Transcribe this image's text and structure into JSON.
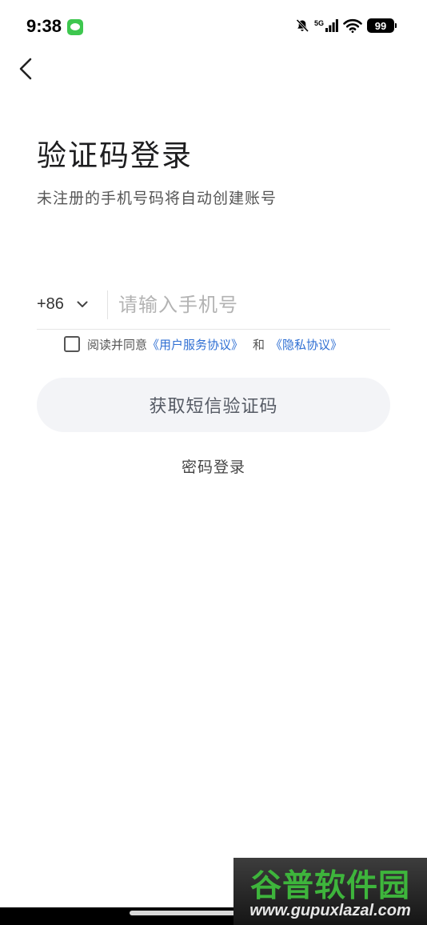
{
  "status_bar": {
    "time": "9:38",
    "network": "5G",
    "battery": "99",
    "icons": [
      "message-icon",
      "bell-off-icon",
      "signal-icon",
      "wifi-icon",
      "battery-icon"
    ]
  },
  "header": {
    "back_icon": "chevron-left-icon"
  },
  "page": {
    "title": "验证码登录",
    "subtitle": "未注册的手机号码将自动创建账号"
  },
  "phone": {
    "country_code": "+86",
    "placeholder": "请输入手机号",
    "value": ""
  },
  "agreement": {
    "prefix": "阅读并同意",
    "user_agreement": "《用户服务协议》",
    "and": "和",
    "privacy_policy": "《隐私协议》",
    "checked": false
  },
  "actions": {
    "get_sms_code": "获取短信验证码",
    "password_login": "密码登录"
  },
  "watermark": {
    "title": "谷普软件园",
    "url": "www.gupuxlazal.com"
  },
  "colors": {
    "link": "#2f6fd3",
    "button_bg": "#f3f4f7",
    "watermark_green": "#3eb53c"
  }
}
